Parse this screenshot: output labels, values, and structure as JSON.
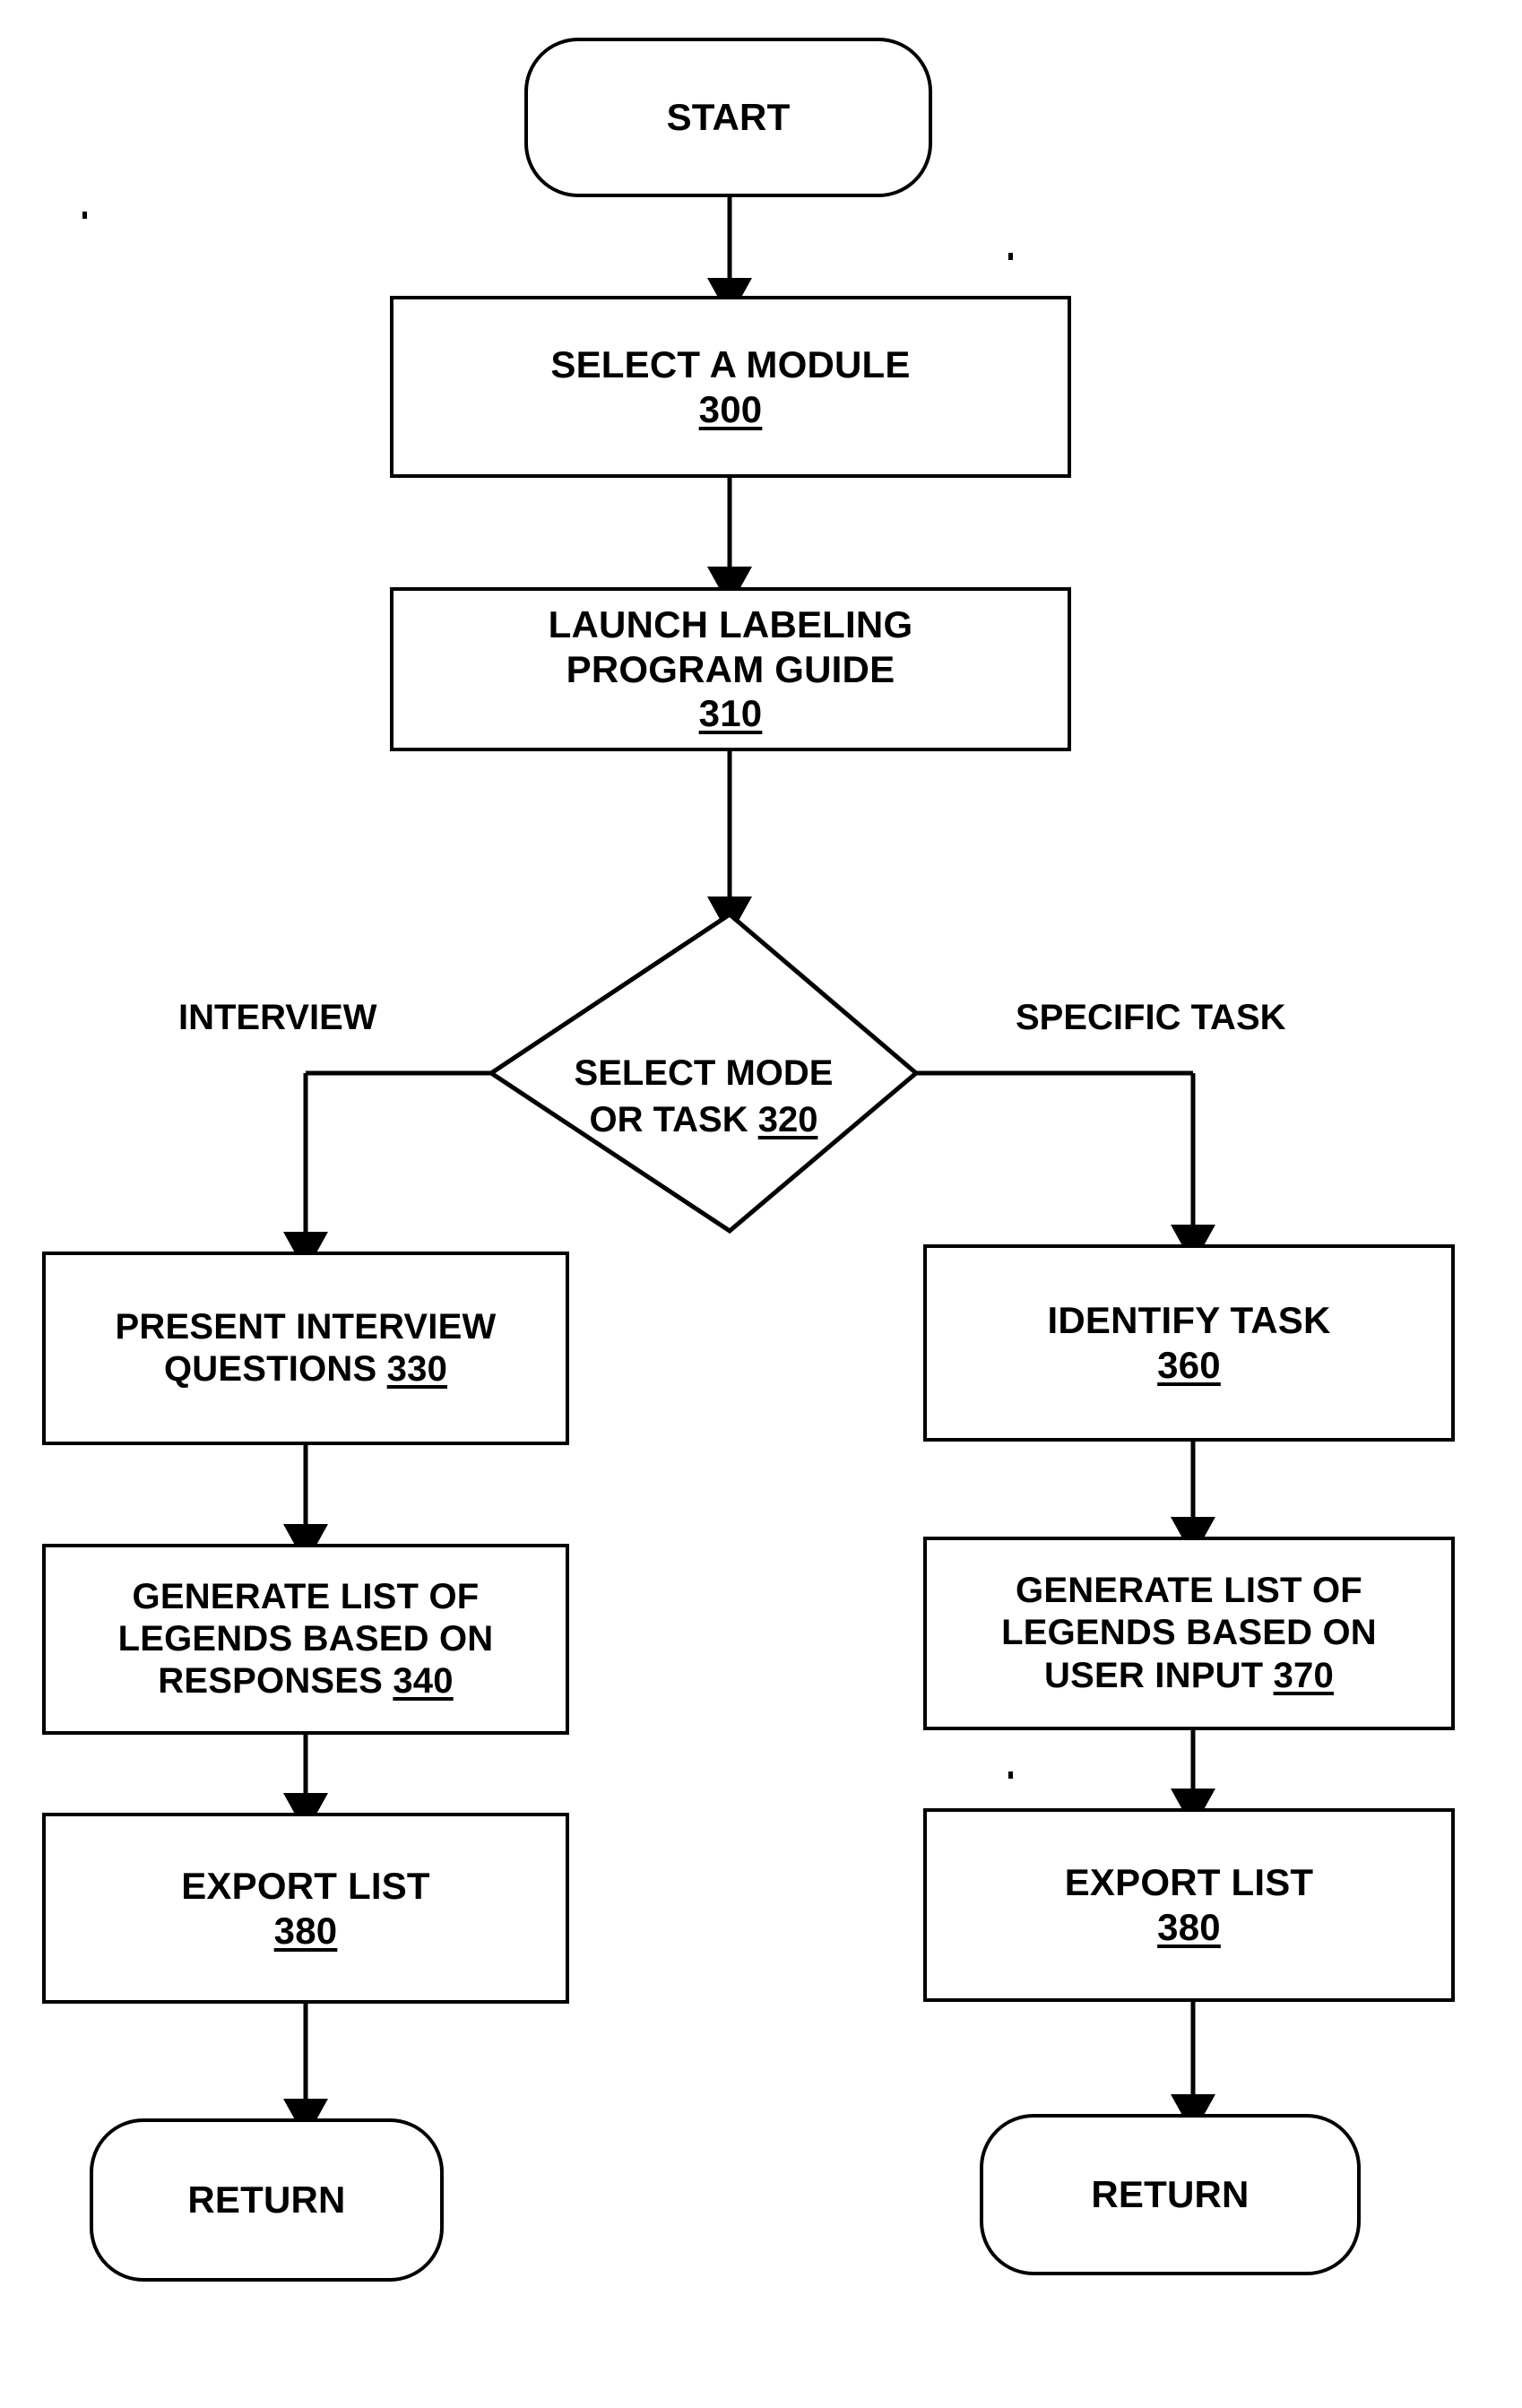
{
  "figure": {
    "type": "flowchart",
    "orientation": "top-to-bottom, two branches",
    "background_color": "#ffffff",
    "line_color": "#000000"
  },
  "nodes": {
    "start": {
      "label": "START",
      "shape": "terminator"
    },
    "select_module": {
      "label": "SELECT A MODULE",
      "ref": "300",
      "shape": "process"
    },
    "launch_guide": {
      "label": "LAUNCH LABELING\nPROGRAM GUIDE",
      "ref": "310",
      "shape": "process"
    },
    "decision": {
      "label": "SELECT MODE\nOR TASK ",
      "ref": "320",
      "shape": "decision"
    },
    "present_questions": {
      "label": "PRESENT INTERVIEW\nQUESTIONS ",
      "ref": "330",
      "shape": "process"
    },
    "generate_responses": {
      "label": "GENERATE LIST OF\nLEGENDS BASED ON\nRESPONSES ",
      "ref": "340",
      "shape": "process"
    },
    "export_left": {
      "label": "EXPORT LIST",
      "ref": "380",
      "shape": "process"
    },
    "return_left": {
      "label": "RETURN",
      "shape": "terminator"
    },
    "identify_task": {
      "label": "IDENTIFY TASK",
      "ref": "360",
      "shape": "process"
    },
    "generate_user_input": {
      "label": "GENERATE LIST OF\nLEGENDS BASED ON\nUSER INPUT ",
      "ref": "370",
      "shape": "process"
    },
    "export_right": {
      "label": "EXPORT LIST",
      "ref": "380",
      "shape": "process"
    },
    "return_right": {
      "label": "RETURN",
      "shape": "terminator"
    }
  },
  "edge_labels": {
    "interview": "INTERVIEW",
    "specific_task": "SPECIFIC TASK"
  }
}
